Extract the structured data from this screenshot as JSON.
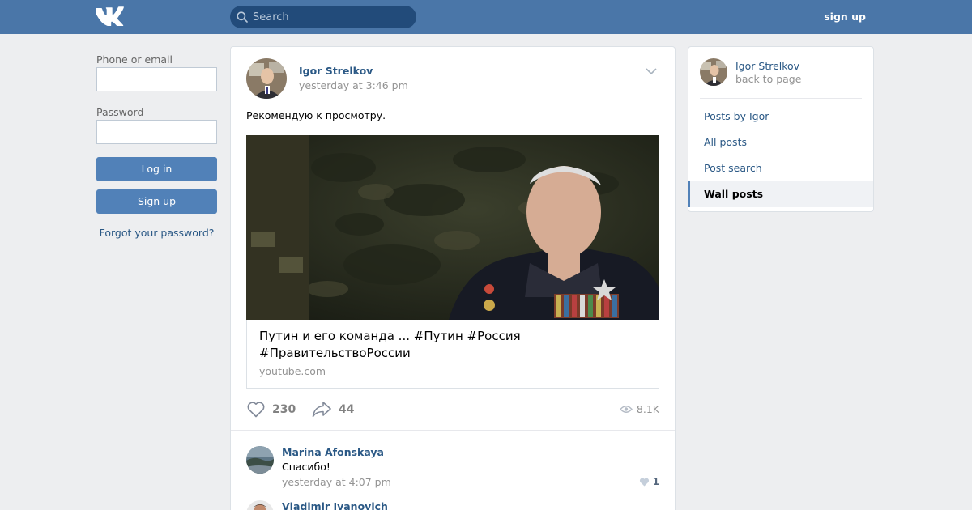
{
  "header": {
    "logo_icon": "vk-logo-icon",
    "search_placeholder": "Search",
    "signup_label": "sign up"
  },
  "login": {
    "phone_label": "Phone or email",
    "phone_value": "",
    "password_label": "Password",
    "password_value": "",
    "login_button": "Log in",
    "signup_button": "Sign up",
    "forgot_link": "Forgot your password?"
  },
  "post": {
    "author": "Igor Strelkov",
    "time": "yesterday at 3:46 pm",
    "text": "Рекомендую к просмотру.",
    "link_title": "Путин и его команда ... #Путин #Россия #ПравительствоРоссии",
    "link_source": "youtube.com",
    "likes": "230",
    "shares": "44",
    "views": "8.1K"
  },
  "comments": [
    {
      "author": "Marina Afonskaya",
      "text": "Спасибо!",
      "time": "yesterday at 4:07 pm",
      "likes": "1"
    },
    {
      "author": "Vladimir Ivanovich",
      "text": "",
      "time": "",
      "likes": ""
    }
  ],
  "sidebar": {
    "name": "Igor Strelkov",
    "back": "back to page",
    "items": [
      {
        "label": "Posts by Igor",
        "active": false
      },
      {
        "label": "All posts",
        "active": false
      },
      {
        "label": "Post search",
        "active": false
      },
      {
        "label": "Wall posts",
        "active": true
      }
    ]
  },
  "colors": {
    "header_bg": "#4a76a8",
    "accent": "#5181b8",
    "link": "#2a5885",
    "page_bg": "#edeef0"
  }
}
